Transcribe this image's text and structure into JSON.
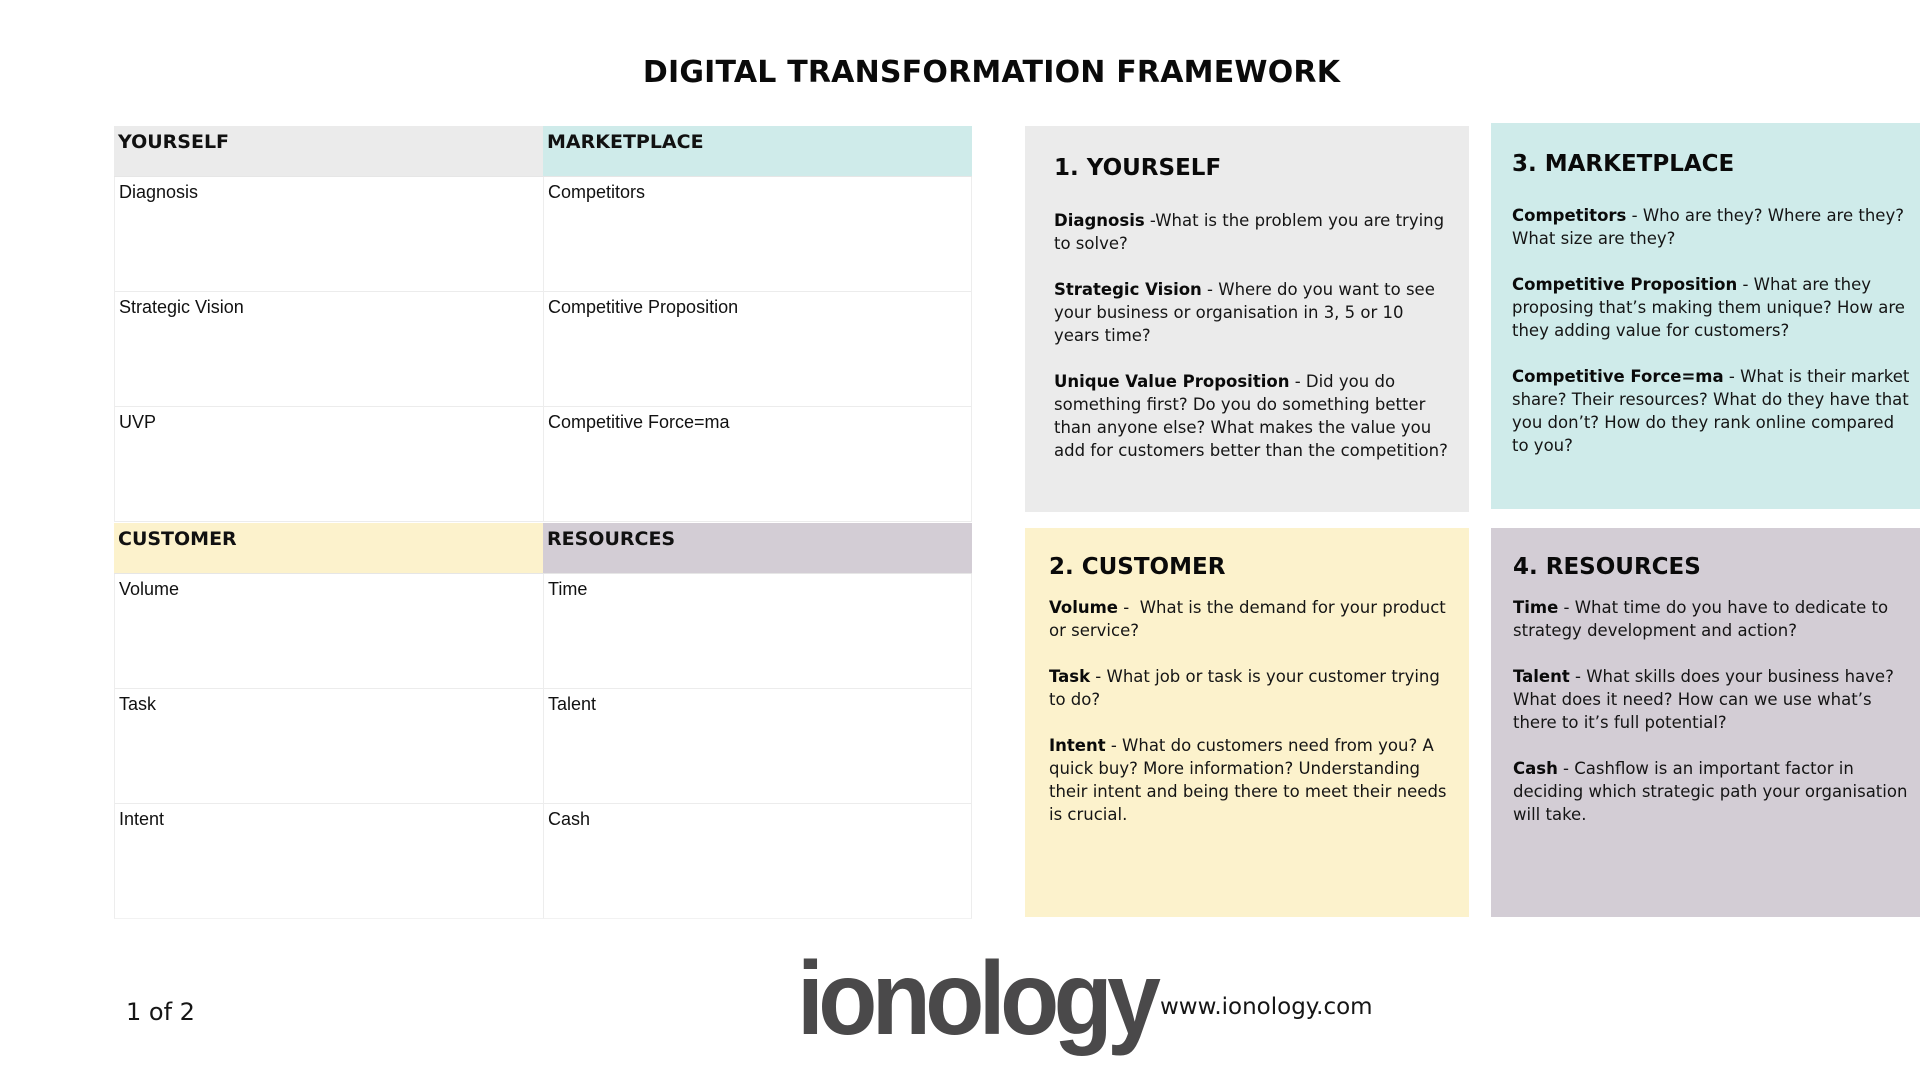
{
  "title": "DIGITAL TRANSFORMATION FRAMEWORK",
  "colors": {
    "yourself": "#ebebeb",
    "marketplace": "#cfebea",
    "customer": "#fcf2cc",
    "resources": "#d3cdd5",
    "logo": "#4a494a"
  },
  "worksheet": {
    "top": {
      "headers": [
        "YOURSELF",
        "MARKETPLACE"
      ],
      "rows": [
        [
          "Diagnosis",
          "Competitors"
        ],
        [
          "Strategic Vision",
          "Competitive Proposition"
        ],
        [
          "UVP",
          "Competitive Force=ma"
        ]
      ]
    },
    "bottom": {
      "headers": [
        "CUSTOMER",
        "RESOURCES"
      ],
      "rows": [
        [
          "Volume",
          "Time"
        ],
        [
          "Task",
          "Talent"
        ],
        [
          "Intent",
          "Cash"
        ]
      ]
    }
  },
  "panels": {
    "yourself": {
      "title": "1. YOURSELF",
      "items": [
        {
          "term": "Diagnosis",
          "text": " -What is the problem you are trying to solve?"
        },
        {
          "term": "Strategic Vision",
          "text": " - Where do you want to see your business or organisation in 3, 5 or 10 years time?"
        },
        {
          "term": "Unique Value Proposition",
          "text": " - Did you do something first? Do you do something better than anyone else? What makes the value you add for customers better than the competition?"
        }
      ]
    },
    "marketplace": {
      "title": "3. MARKETPLACE",
      "items": [
        {
          "term": "Competitors",
          "text": " - Who are they? Where are they? What size are they?"
        },
        {
          "term": "Competitive Proposition",
          "text": " - What are they proposing that’s making them unique? How are they adding value for customers?"
        },
        {
          "term": "Competitive Force=ma",
          "text": " - What is their market share? Their resources? What do they have that you don’t? How do they rank online compared to you?"
        }
      ]
    },
    "customer": {
      "title": "2. CUSTOMER",
      "items": [
        {
          "term": "Volume",
          "text": " -  What is the demand for your product or service?"
        },
        {
          "term": "Task",
          "text": " - What job or task is your customer trying to do?"
        },
        {
          "term": "Intent",
          "text": " - What do customers need from you? A quick buy? More information? Understanding their intent and being there to meet their needs is crucial."
        }
      ]
    },
    "resources": {
      "title": "4. RESOURCES",
      "items": [
        {
          "term": "Time",
          "text": " - What time do you have to dedicate to strategy development and action?"
        },
        {
          "term": "Talent",
          "text": " - What skills does your business have? What does it need? How can we use what’s there to it’s full potential?"
        },
        {
          "term": "Cash",
          "text": " - Cashflow is an important factor in deciding which strategic path your organisation will take."
        }
      ]
    }
  },
  "footer": {
    "page_number": "1 of 2",
    "logo_text": "ionology",
    "website": "www.ionology.com"
  }
}
